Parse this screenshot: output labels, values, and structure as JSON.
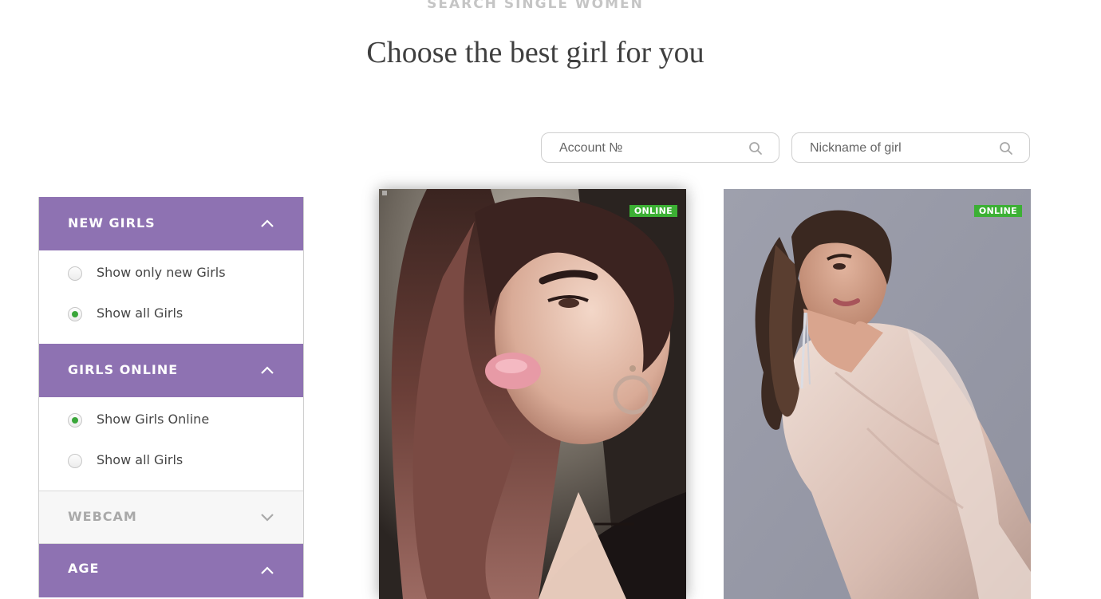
{
  "header": {
    "kicker": "SEARCH SINGLE WOMEN",
    "title": "Choose the best girl for you"
  },
  "search": {
    "account_placeholder": "Account №",
    "nickname_placeholder": "Nickname of girl"
  },
  "filters": {
    "new_girls": {
      "title": "NEW GIRLS",
      "expanded": true,
      "options": [
        {
          "label": "Show only new Girls",
          "checked": false
        },
        {
          "label": "Show all Girls",
          "checked": true
        }
      ]
    },
    "girls_online": {
      "title": "GIRLS ONLINE",
      "expanded": true,
      "options": [
        {
          "label": "Show Girls Online",
          "checked": true
        },
        {
          "label": "Show all Girls",
          "checked": false
        }
      ]
    },
    "webcam": {
      "title": "WEBCAM",
      "expanded": false
    },
    "age": {
      "title": "AGE",
      "expanded": true
    }
  },
  "cards": [
    {
      "status": "ONLINE"
    },
    {
      "status": "ONLINE"
    }
  ],
  "colors": {
    "accent": "#8e72b2",
    "online_badge": "#3cb034",
    "radio_checked": "#3aa63a"
  }
}
